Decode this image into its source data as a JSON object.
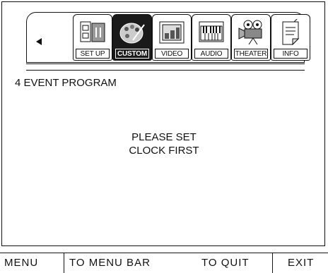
{
  "nav": {
    "back_icon": "left-triangle-icon",
    "tabs": [
      {
        "label": "SET UP",
        "icon": "outlet-icon",
        "active": false
      },
      {
        "label": "CUSTOM",
        "icon": "palette-icon",
        "active": true
      },
      {
        "label": "VIDEO",
        "icon": "tv-icon",
        "active": false
      },
      {
        "label": "AUDIO",
        "icon": "keyboard-icon",
        "active": false
      },
      {
        "label": "THEATER",
        "icon": "projector-icon",
        "active": false
      },
      {
        "label": "INFO",
        "icon": "document-icon",
        "active": false
      }
    ]
  },
  "main": {
    "section_title": "4 EVENT PROGRAM",
    "message_line1": "PLEASE SET",
    "message_line2": "CLOCK FIRST"
  },
  "footer": {
    "left_label": "MENU",
    "middle_left_label": "TO MENU BAR",
    "middle_right_label": "TO QUIT",
    "right_label": "EXIT"
  }
}
